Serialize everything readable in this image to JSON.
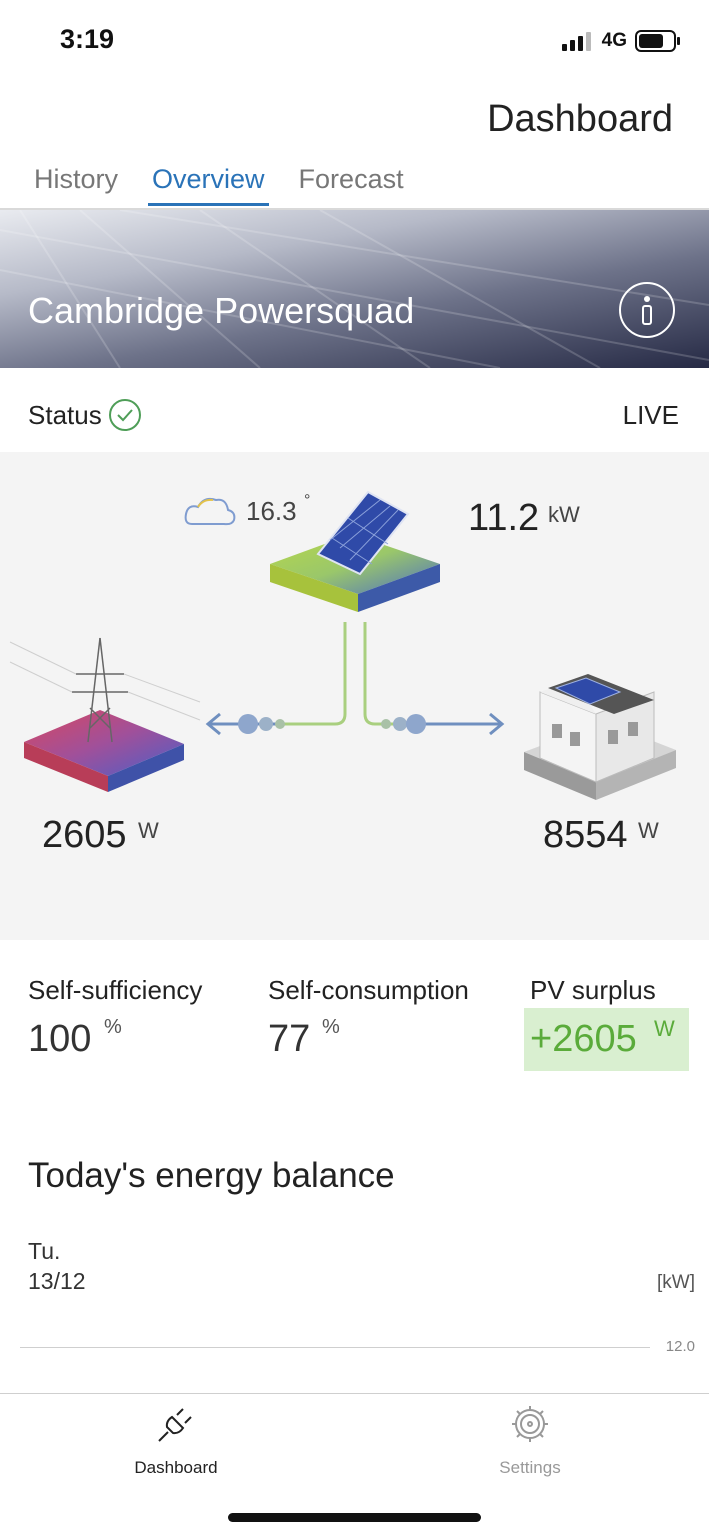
{
  "status_bar": {
    "time": "3:19",
    "network": "4G",
    "icons": [
      "signal-icon",
      "battery-icon"
    ]
  },
  "header": {
    "title": "Dashboard"
  },
  "tabs": [
    {
      "label": "History",
      "active": false
    },
    {
      "label": "Overview",
      "active": true
    },
    {
      "label": "Forecast",
      "active": false
    }
  ],
  "banner": {
    "title": "Cambridge Powersquad",
    "info_icon": "info-icon"
  },
  "status": {
    "label": "Status",
    "mode": "LIVE",
    "icon": "check-circle-icon"
  },
  "energy": {
    "temperature": "16.3",
    "temperature_unit": "°",
    "weather_icon": "cloud-icon",
    "pv_power": "11.2",
    "pv_unit": "kW",
    "grid_power": "2605",
    "grid_unit": "W",
    "house_power": "8554",
    "house_unit": "W"
  },
  "kpis": {
    "self_sufficiency": {
      "label": "Self-sufficiency",
      "value": "100",
      "unit": "%"
    },
    "self_consumption": {
      "label": "Self-consumption",
      "value": "77",
      "unit": "%"
    },
    "pv_surplus": {
      "label": "PV surplus",
      "value": "+2605",
      "unit": "W"
    }
  },
  "balance": {
    "title": "Today's energy balance",
    "day": "Tu.",
    "date": "13/12",
    "unit": "[kW]",
    "y_tick": "12.0"
  },
  "nav": {
    "dashboard_label": "Dashboard",
    "settings_label": "Settings"
  },
  "colors": {
    "accent": "#2a73b8",
    "surplus_green": "#5aab3a",
    "surplus_bg": "#d9efd0",
    "flow_blue": "#6f8fbf",
    "flow_green": "#a9cf7f"
  }
}
